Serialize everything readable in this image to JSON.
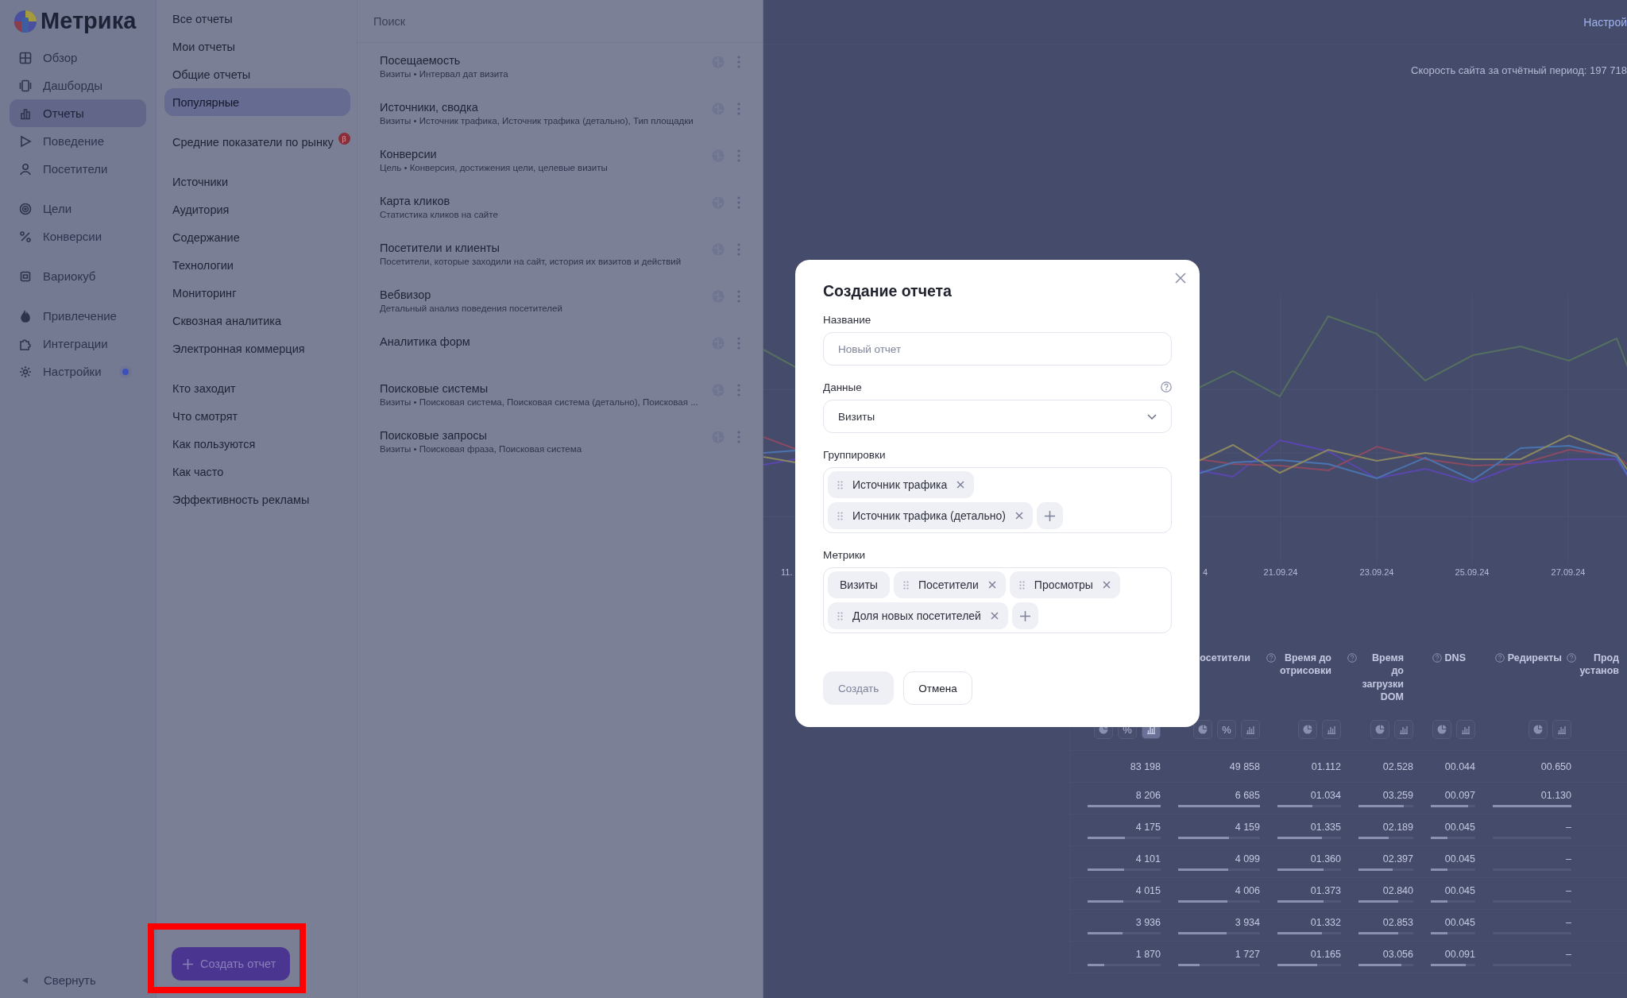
{
  "nav": {
    "logo": "Метрика",
    "groups": [
      {
        "items": [
          {
            "label": "Обзор",
            "selected": false,
            "dot": false
          },
          {
            "label": "Дашборды",
            "selected": false,
            "dot": false
          },
          {
            "label": "Отчеты",
            "selected": true,
            "dot": false
          },
          {
            "label": "Поведение",
            "selected": false,
            "dot": false
          },
          {
            "label": "Посетители",
            "selected": false,
            "dot": false
          }
        ]
      },
      {
        "items": [
          {
            "label": "Цели",
            "selected": false,
            "dot": false
          },
          {
            "label": "Конверсии",
            "selected": false,
            "dot": false
          }
        ]
      },
      {
        "items": [
          {
            "label": "Вариокуб",
            "selected": false,
            "dot": false
          }
        ]
      },
      {
        "items": [
          {
            "label": "Привлечение",
            "selected": false,
            "dot": false
          },
          {
            "label": "Интеграции",
            "selected": false,
            "dot": false
          },
          {
            "label": "Настройки",
            "selected": false,
            "dot": true
          }
        ]
      }
    ],
    "collapse": "Свернуть"
  },
  "reports_menu": {
    "groups": [
      {
        "items": [
          {
            "label": "Все отчеты",
            "selected": false
          },
          {
            "label": "Мои отчеты",
            "selected": false
          },
          {
            "label": "Общие отчеты",
            "selected": false
          },
          {
            "label": "Популярные",
            "selected": true
          }
        ]
      },
      {
        "items": [
          {
            "label": "Средние показатели по рынку",
            "selected": false,
            "badge": "β"
          }
        ]
      },
      {
        "items": [
          {
            "label": "Источники",
            "selected": false
          },
          {
            "label": "Аудитория",
            "selected": false
          },
          {
            "label": "Содержание",
            "selected": false
          },
          {
            "label": "Технологии",
            "selected": false
          },
          {
            "label": "Мониторинг",
            "selected": false
          },
          {
            "label": "Сквозная аналитика",
            "selected": false
          },
          {
            "label": "Электронная коммерция",
            "selected": false
          }
        ]
      },
      {
        "items": [
          {
            "label": "Кто заходит",
            "selected": false
          },
          {
            "label": "Что смотрят",
            "selected": false
          },
          {
            "label": "Как пользуются",
            "selected": false
          },
          {
            "label": "Как часто",
            "selected": false
          },
          {
            "label": "Эффективность рекламы",
            "selected": false
          }
        ]
      }
    ],
    "create_button": "Создать отчет"
  },
  "report_list": {
    "search": {
      "placeholder": "Поиск"
    },
    "items": [
      {
        "title": "Посещаемость",
        "subtitle": "Визиты • Интервал дат визита"
      },
      {
        "title": "Источники, сводка",
        "subtitle": "Визиты • Источник трафика, Источник трафика (детально), Тип площадки"
      },
      {
        "title": "Конверсии",
        "subtitle": "Цель • Конверсия, достижения цели, целевые визиты"
      },
      {
        "title": "Карта кликов",
        "subtitle": "Статистика кликов на сайте"
      },
      {
        "title": "Посетители и клиенты",
        "subtitle": "Посетители, которые заходили на сайт, история их визитов и действий"
      },
      {
        "title": "Вебвизор",
        "subtitle": "Детальный анализ поведения посетителей"
      },
      {
        "title": "Аналитика форм"
      },
      {
        "title": "Поисковые системы",
        "subtitle": "Визиты • Поисковая система, Поисковая система (детально), Поисковая ..."
      },
      {
        "title": "Поисковые запросы",
        "subtitle": "Визиты • Поисковая фраза, Поисковая система"
      }
    ]
  },
  "main": {
    "settings_link": "Настрой",
    "speed_note": "Скорость сайта за отчётный период: 197 718",
    "chart": {
      "x_labels": [
        "11.",
        "4",
        "21.09.24",
        "23.09.24",
        "25.09.24",
        "27.09.24"
      ]
    },
    "table": {
      "columns": [
        {
          "view_buttons": [
            {
              "kind": "pie",
              "selected": false
            },
            {
              "kind": "percent",
              "label": "%",
              "selected": false
            },
            {
              "kind": "bars",
              "selected": true
            }
          ]
        },
        {
          "header": "осетители",
          "help": false,
          "view_buttons": [
            {
              "kind": "pie",
              "selected": false
            },
            {
              "kind": "percent",
              "label": "%",
              "selected": false
            },
            {
              "kind": "bars",
              "selected": false
            }
          ]
        },
        {
          "header": "Время до отрисовки",
          "help": true,
          "view_buttons": [
            {
              "kind": "pie",
              "selected": false
            },
            {
              "kind": "bars",
              "selected": false
            }
          ]
        },
        {
          "header": "Время до загрузки DOM",
          "help": true,
          "view_buttons": [
            {
              "kind": "pie",
              "selected": false
            },
            {
              "kind": "bars",
              "selected": false
            }
          ]
        },
        {
          "header": "DNS",
          "help": true,
          "view_buttons": [
            {
              "kind": "pie",
              "selected": false
            },
            {
              "kind": "bars",
              "selected": false
            }
          ]
        },
        {
          "header": "Редиректы",
          "help": true,
          "view_buttons": [
            {
              "kind": "pie",
              "selected": false
            },
            {
              "kind": "bars",
              "selected": false
            }
          ]
        },
        {
          "header": "Прод установ",
          "help": true
        }
      ],
      "rows": [
        {
          "cells": [
            {
              "value": "83 198"
            },
            {
              "value": "49 858"
            },
            {
              "value": "01.112"
            },
            {
              "value": "02.528"
            },
            {
              "value": "00.044"
            },
            {
              "value": "00.650"
            }
          ]
        },
        {
          "cells": [
            {
              "value": "8 206",
              "level": 1
            },
            {
              "value": "6 685",
              "level": 1
            },
            {
              "value": "01.034",
              "level": 0.55
            },
            {
              "value": "03.259",
              "level": 0.83
            },
            {
              "value": "00.097",
              "level": 0.84
            },
            {
              "value": "01.130",
              "level": 1
            }
          ]
        },
        {
          "cells": [
            {
              "value": "4 175",
              "level": 0.51
            },
            {
              "value": "4 159",
              "level": 0.62
            },
            {
              "value": "01.335",
              "level": 0.7
            },
            {
              "value": "02.189",
              "level": 0.55
            },
            {
              "value": "00.045",
              "level": 0.37
            },
            {
              "value": "–"
            }
          ]
        },
        {
          "cells": [
            {
              "value": "4 101",
              "level": 0.5
            },
            {
              "value": "4 099",
              "level": 0.61
            },
            {
              "value": "01.360",
              "level": 0.73
            },
            {
              "value": "02.397",
              "level": 0.62
            },
            {
              "value": "00.045",
              "level": 0.37
            },
            {
              "value": "–"
            }
          ]
        },
        {
          "cells": [
            {
              "value": "4 015",
              "level": 0.49
            },
            {
              "value": "4 006",
              "level": 0.6
            },
            {
              "value": "01.373",
              "level": 0.73
            },
            {
              "value": "02.840",
              "level": 0.72
            },
            {
              "value": "00.045",
              "level": 0.37
            },
            {
              "value": "–"
            }
          ]
        },
        {
          "cells": [
            {
              "value": "3 936",
              "level": 0.48
            },
            {
              "value": "3 934",
              "level": 0.59
            },
            {
              "value": "01.332",
              "level": 0.7
            },
            {
              "value": "02.853",
              "level": 0.73
            },
            {
              "value": "00.045",
              "level": 0.37
            },
            {
              "value": "–"
            }
          ]
        },
        {
          "cells": [
            {
              "value": "1 870",
              "level": 0.23
            },
            {
              "value": "1 727",
              "level": 0.26
            },
            {
              "value": "01.165",
              "level": 0.62
            },
            {
              "value": "03.056",
              "level": 0.78
            },
            {
              "value": "00.091",
              "level": 0.78
            },
            {
              "value": "–"
            }
          ]
        }
      ]
    }
  },
  "modal": {
    "title": "Создание отчета",
    "name_field": {
      "label": "Название",
      "placeholder": "Новый отчет"
    },
    "data_field": {
      "label": "Данные",
      "value": "Визиты"
    },
    "groupings": {
      "label": "Группировки",
      "chips": [
        {
          "label": "Источник трафика",
          "removable": true
        },
        {
          "label": "Источник трафика (детально)",
          "removable": true
        }
      ]
    },
    "metrics": {
      "label": "Метрики",
      "chips": [
        {
          "label": "Визиты",
          "removable": false
        },
        {
          "label": "Посетители",
          "removable": true
        },
        {
          "label": "Просмотры",
          "removable": true
        },
        {
          "label": "Доля новых посетителей",
          "removable": true
        }
      ]
    },
    "buttons": [
      {
        "label": "Создать",
        "disabled": true
      },
      {
        "label": "Отмена",
        "disabled": false
      }
    ]
  }
}
